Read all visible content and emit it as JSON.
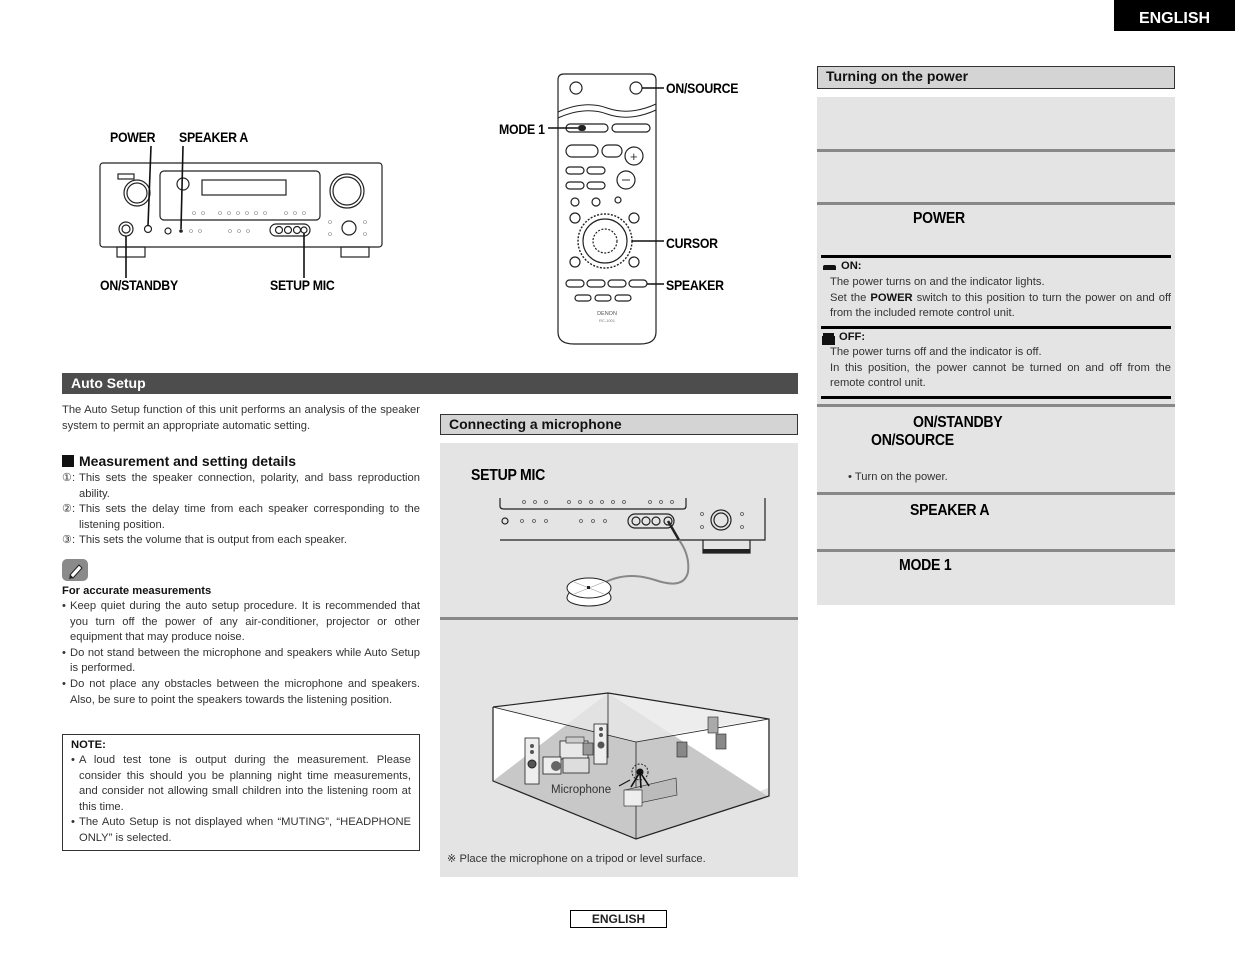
{
  "language_tab": "ENGLISH",
  "footer_language": "ENGLISH",
  "receiver_diagram": {
    "callouts": {
      "power": "POWER",
      "speaker_a": "SPEAKER A",
      "on_standby": "ON/STANDBY",
      "setup_mic": "SETUP MIC"
    }
  },
  "remote_diagram": {
    "brand": "DENON",
    "model": "RC-1001",
    "callouts": {
      "on_source": "ON/SOURCE",
      "mode1": "MODE 1",
      "cursor": "CURSOR",
      "speaker": "SPEAKER"
    }
  },
  "auto_setup": {
    "title": "Auto Setup",
    "intro": "The Auto Setup function of this unit performs an analysis of the speaker system to permit an appropriate automatic setting.",
    "measurement_title": "Measurement and setting details",
    "measurement_items": [
      {
        "num": "①:",
        "text": "This sets the speaker connection, polarity, and bass reproduction ability."
      },
      {
        "num": "②:",
        "text": "This sets the delay time from each speaker corresponding to the listening position."
      },
      {
        "num": "③:",
        "text": "This sets the volume that is output from each speaker."
      }
    ],
    "pencil_icon": "pencil-icon",
    "accurate_title": "For accurate measurements",
    "accurate_items": [
      "Keep quiet during the auto setup procedure. It is recommended that you turn off the power of any air-conditioner, projector or other equipment that may produce noise.",
      "Do not stand between the microphone and speakers while Auto Setup is performed.",
      "Do not place any obstacles between the microphone and speakers. Also, be sure to point the speakers towards the listening position."
    ],
    "note": {
      "title": "NOTE:",
      "items": [
        "A loud test tone is output during the measurement. Please consider this should you be planning night time measurements, and consider not allowing small children into the listening room at this time.",
        "The Auto Setup is not displayed when “MUTING”, “HEADPHONE ONLY” is selected."
      ]
    }
  },
  "connecting_mic": {
    "title": "Connecting a microphone",
    "setup_mic_label": "SETUP MIC",
    "microphone_label": "Microphone",
    "tripod_note": "※  Place the microphone on a tripod or level surface."
  },
  "turning_on": {
    "title": "Turning on the power",
    "steps": {
      "power": "POWER",
      "on_standby": "ON/STANDBY",
      "on_source": "ON/SOURCE",
      "turn_on_bullet": "• Turn on the power.",
      "speaker_a": "SPEAKER A",
      "mode1": "MODE 1"
    },
    "on": {
      "title": "ON:",
      "line1": "The power turns on and the indicator lights.",
      "line2_prefix": "Set the ",
      "line2_bold": "POWER",
      "line2_suffix": " switch to this position to turn the power on and off from the included remote control unit."
    },
    "off": {
      "title": "OFF:",
      "line1": "The power turns off and the indicator is off.",
      "line2": "In this position, the power cannot be turned on and off from the remote control unit."
    }
  }
}
